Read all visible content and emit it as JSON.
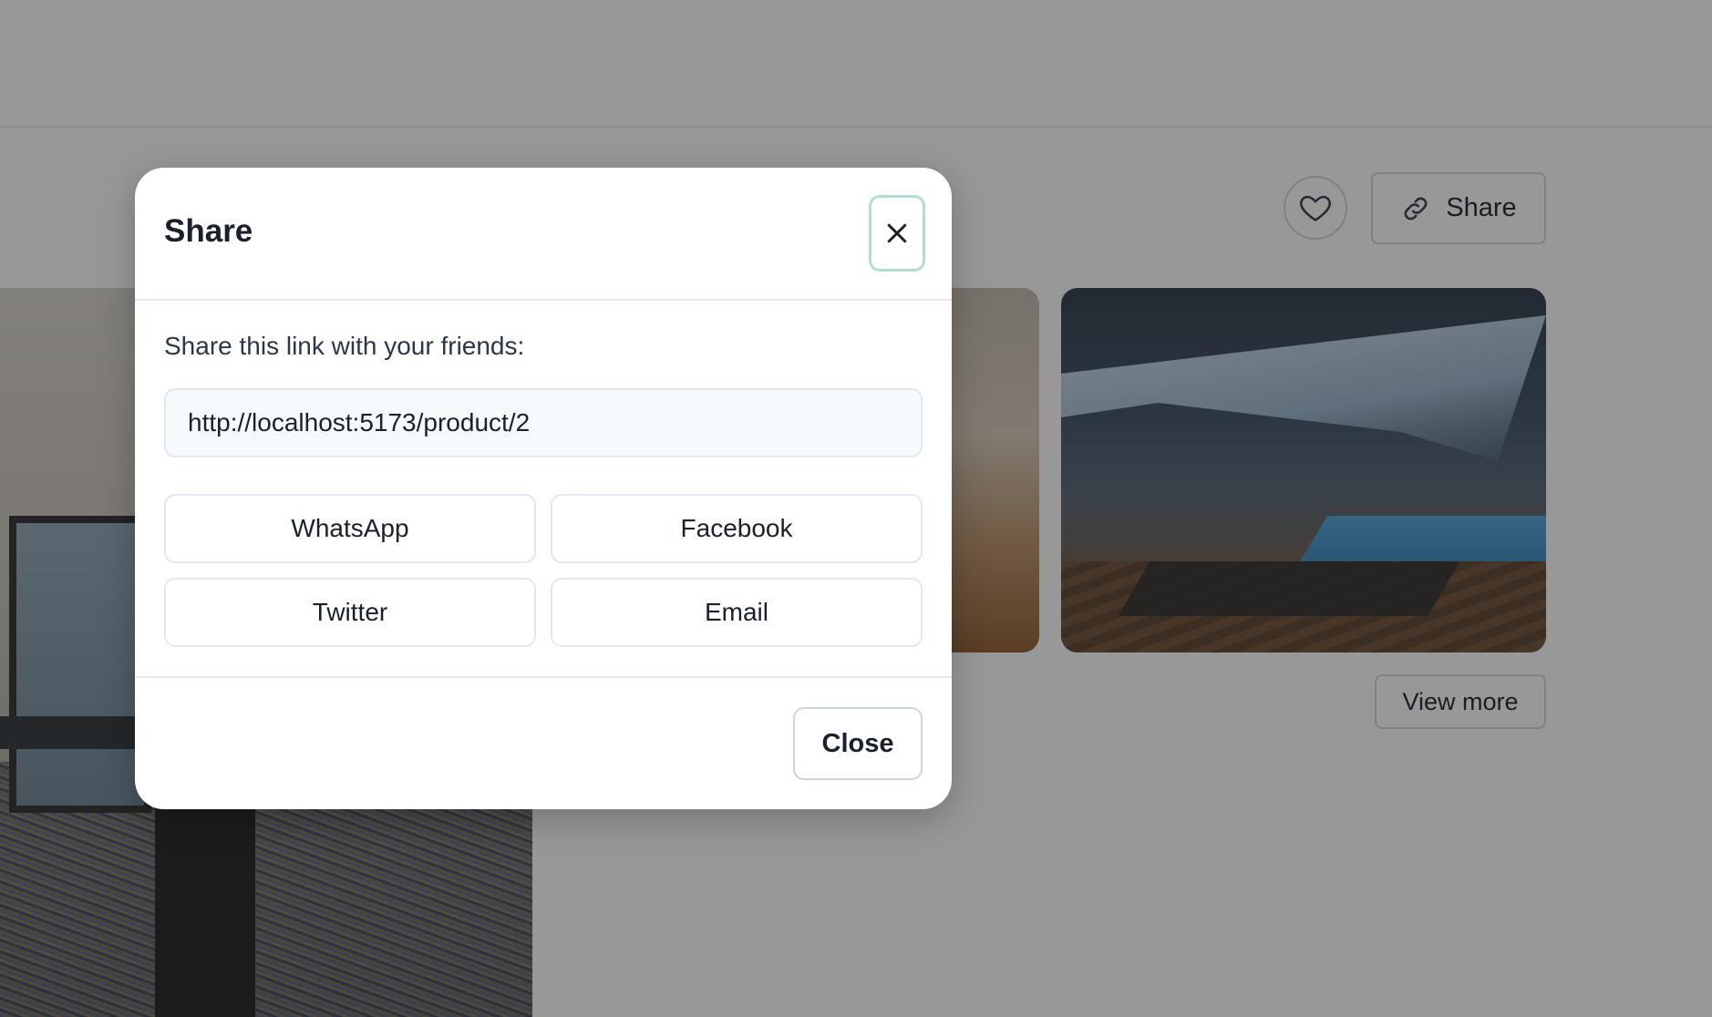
{
  "background": {
    "share_button_label": "Share",
    "view_more_label": "View more",
    "favorite_icon": "heart-icon",
    "share_icon": "link-icon"
  },
  "modal": {
    "title": "Share",
    "close_icon": "close-icon",
    "description": "Share this link with your friends:",
    "link_value": "http://localhost:5173/product/2",
    "share_options": [
      "WhatsApp",
      "Facebook",
      "Twitter",
      "Email"
    ],
    "close_label": "Close"
  },
  "colors": {
    "overlay": "#1a1a1a",
    "border": "#e2e8f0",
    "focus_ring": "#b5ddcc",
    "text": "#1a202c"
  }
}
